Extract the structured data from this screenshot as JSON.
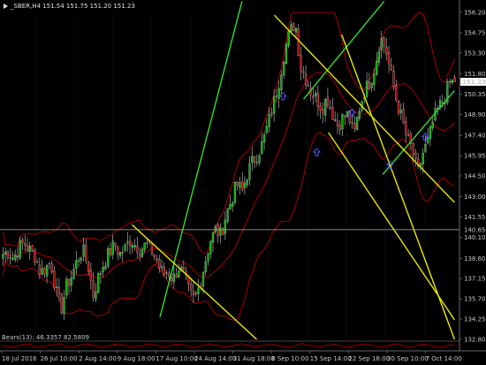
{
  "header": {
    "symbol_line": "_SBER,H4  151.54 151.75 151.20 151.23",
    "oscillator_label": "Bears(13): 46.3357 82.5809"
  },
  "colors": {
    "background": "#000000",
    "grid": "#1a1a1a",
    "bull_candle": "#00b000",
    "bear_candle": "#b00000",
    "bands": "#cc0000",
    "trendline_green": "#32dc32",
    "trendline_yellow": "#e8e800",
    "arrow": "#5060ff",
    "price_tag_bg": "#ffffff",
    "price_tag_text": "#000000",
    "ref_line": "#b4b4b4"
  },
  "price_axis": {
    "labels": [
      "156.20",
      "154.75",
      "153.30",
      "151.80",
      "150.35",
      "148.90",
      "147.40",
      "145.95",
      "144.50",
      "143.00",
      "141.55",
      "140.10",
      "138.60",
      "137.15",
      "135.70",
      "134.25",
      "132.80"
    ],
    "current_price": "151.23",
    "reference_price": "140.65"
  },
  "time_axis": {
    "labels": [
      "18 Jul 2016",
      "26 Jul 10:00",
      "2 Aug 14:00",
      "9 Aug 18:00",
      "17 Aug 10:00",
      "24 Aug 14:00",
      "31 Aug 18:00",
      "8 Sep 10:00",
      "15 Sep 14:00",
      "22 Sep 18:00",
      "30 Sep 10:00",
      "7 Oct 14:00"
    ]
  },
  "chart_data": {
    "type": "candlestick",
    "title": "_SBER,H4",
    "indicators": [
      "Bollinger Bands",
      "Bears Power"
    ],
    "ylim": [
      132.8,
      156.2
    ],
    "anchor_closes": [
      138.9,
      139.1,
      138.6,
      139.4,
      139.7,
      139.2,
      138.8,
      137.6,
      137.9,
      138.4,
      136.2,
      135.1,
      136.7,
      137.4,
      138.5,
      139.2,
      138.1,
      136.0,
      137.3,
      138.3,
      139.0,
      139.6,
      138.9,
      139.3,
      140.0,
      139.5,
      139.3,
      139.6,
      139.1,
      138.4,
      137.4,
      137.7,
      137.1,
      138.0,
      137.4,
      136.2,
      135.6,
      136.7,
      138.3,
      139.9,
      140.6,
      140.3,
      141.8,
      142.8,
      143.9,
      143.4,
      144.7,
      145.6,
      146.1,
      147.0,
      148.4,
      149.8,
      151.4,
      153.5,
      154.8,
      155.5,
      152.3,
      151.5,
      150.5,
      150.0,
      149.4,
      150.1,
      149.0,
      148.1,
      148.7,
      148.9,
      147.3,
      149.3,
      150.6,
      151.2,
      152.3,
      154.4,
      153.6,
      151.7,
      150.0,
      148.6,
      147.2,
      146.4,
      144.6,
      146.1,
      147.0,
      148.5,
      149.4,
      150.0,
      151.2,
      151.2
    ],
    "candle_count": 186,
    "last": {
      "open": 151.54,
      "high": 151.75,
      "low": 151.2,
      "close": 151.23
    },
    "bollinger": {
      "period": 20,
      "deviations": 2
    },
    "trendlines": [
      {
        "color": "green",
        "from": {
          "bar": 108,
          "price": 134.4
        },
        "to": {
          "bar": 164,
          "price": 157.0
        }
      },
      {
        "color": "green",
        "from": {
          "bar": 206,
          "price": 150.0
        },
        "to": {
          "bar": 261,
          "price": 157.0
        }
      },
      {
        "color": "green",
        "from": {
          "bar": 260,
          "price": 144.6
        },
        "to": {
          "bar": 309,
          "price": 150.6
        }
      },
      {
        "color": "yellow",
        "from": {
          "bar": 89,
          "price": 141.0
        },
        "to": {
          "bar": 174,
          "price": 132.8
        }
      },
      {
        "color": "yellow",
        "from": {
          "bar": 186,
          "price": 156.0
        },
        "to": {
          "bar": 309,
          "price": 142.6
        }
      },
      {
        "color": "yellow",
        "from": {
          "bar": 232,
          "price": 154.6
        },
        "to": {
          "bar": 309,
          "price": 132.8
        }
      },
      {
        "color": "yellow",
        "from": {
          "bar": 223,
          "price": 147.6
        },
        "to": {
          "bar": 309,
          "price": 134.2
        }
      }
    ],
    "arrows_up": [
      {
        "bar": 192,
        "price": 150.2
      },
      {
        "bar": 215,
        "price": 146.2
      },
      {
        "bar": 239,
        "price": 149.0
      },
      {
        "bar": 265,
        "price": 145.3
      },
      {
        "bar": 289,
        "price": 147.3
      }
    ]
  }
}
